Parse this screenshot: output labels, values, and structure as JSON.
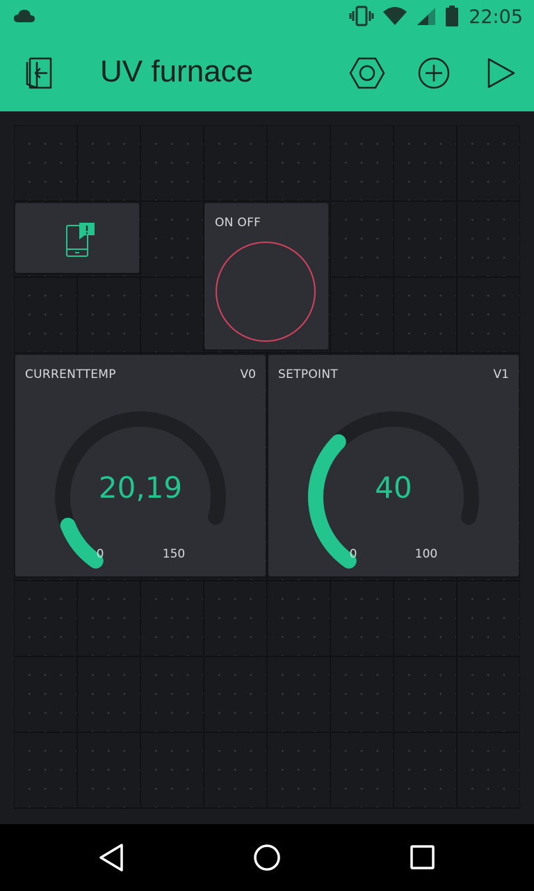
{
  "status_bar": {
    "time": "22:05",
    "icons": [
      "cloud-icon",
      "vibrate-icon",
      "wifi-icon",
      "signal-icon",
      "battery-icon"
    ]
  },
  "toolbar": {
    "title": "UV furnace",
    "icons": [
      "exit-icon",
      "settings-hexagon-icon",
      "add-icon",
      "play-icon"
    ]
  },
  "colors": {
    "accent": "#23c48e",
    "button_red": "#d3435c",
    "background": "#1a1b1f",
    "widget": "#2e2f34"
  },
  "widgets": {
    "notification": {
      "icon": "phone-alert-icon"
    },
    "button": {
      "label": "ON OFF"
    },
    "gauge_current": {
      "label": "CURRENTTEMP",
      "pin": "V0",
      "value": "20,19",
      "min": "0",
      "max": "150",
      "level": 0.1346
    },
    "gauge_setpoint": {
      "label": "SETPOINT",
      "pin": "V1",
      "value": "40",
      "min": "0",
      "max": "100",
      "level": 0.4
    }
  },
  "nav_bar": {
    "icons": [
      "back-icon",
      "home-icon",
      "recents-icon"
    ]
  }
}
